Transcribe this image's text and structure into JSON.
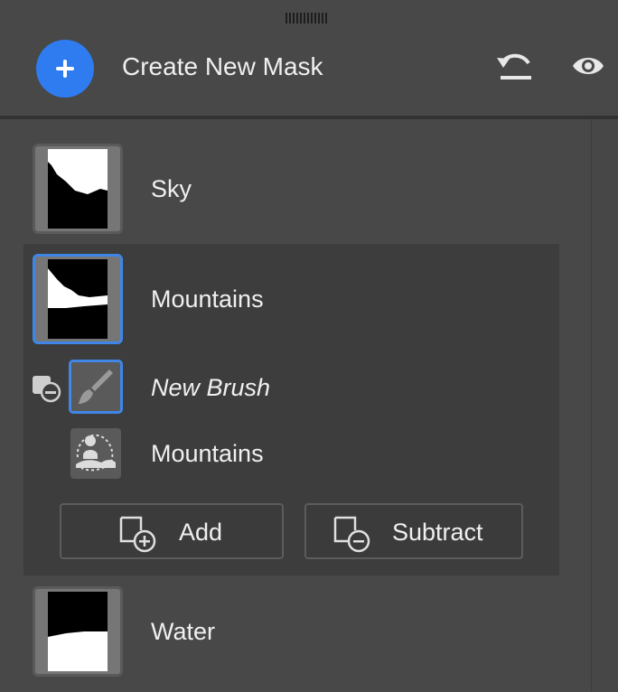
{
  "header": {
    "create_label": "Create New Mask",
    "add_icon": "plus-icon",
    "undo_icon": "undo-icon",
    "visibility_icon": "eye-icon"
  },
  "masks": [
    {
      "name": "Sky",
      "selected": false
    },
    {
      "name": "Mountains",
      "selected": true,
      "components": [
        {
          "name": "New Brush",
          "type": "brush",
          "icon": "brush-icon"
        },
        {
          "name": "Mountains",
          "type": "select-subject",
          "icon": "select-subject-icon"
        }
      ],
      "buttons": {
        "add_label": "Add",
        "subtract_label": "Subtract"
      }
    },
    {
      "name": "Water",
      "selected": false
    }
  ],
  "colors": {
    "accent": "#2f7cf0",
    "selected_border": "#3f86e6",
    "panel_bg": "#484848",
    "group_bg": "#3d3d3d"
  }
}
